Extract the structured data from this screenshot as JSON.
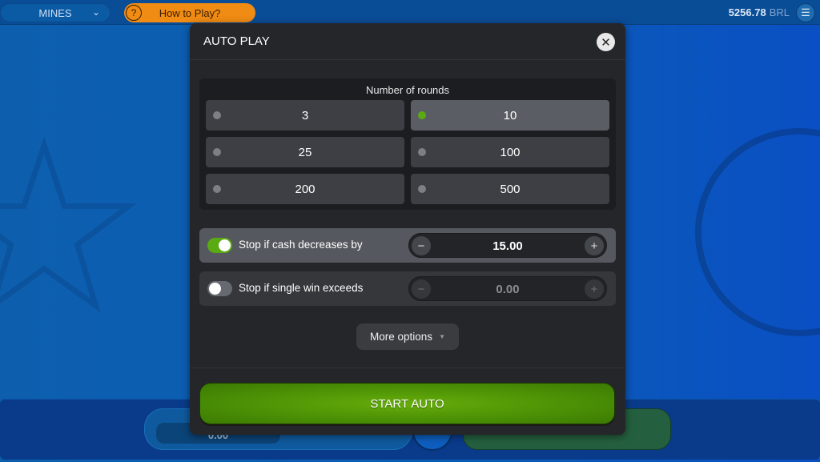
{
  "topbar": {
    "game": "MINES",
    "how_to_play": "How to Play?",
    "balance": "5256.78",
    "currency": "BRL"
  },
  "background": {
    "bet_value": "0.00"
  },
  "modal": {
    "title": "AUTO PLAY",
    "rounds_title": "Number of rounds",
    "rounds": [
      {
        "label": "3",
        "selected": false
      },
      {
        "label": "10",
        "selected": true
      },
      {
        "label": "25",
        "selected": false
      },
      {
        "label": "100",
        "selected": false
      },
      {
        "label": "200",
        "selected": false
      },
      {
        "label": "500",
        "selected": false
      }
    ],
    "stop_cash": {
      "label": "Stop if cash decreases by",
      "enabled": true,
      "value": "15.00"
    },
    "stop_win": {
      "label": "Stop if single win exceeds",
      "enabled": false,
      "value": "0.00"
    },
    "more_options": "More options",
    "start": "START AUTO"
  },
  "colors": {
    "accent": "#5aaa12",
    "modal_bg": "#252629",
    "how_to_play": "#f08c14"
  }
}
